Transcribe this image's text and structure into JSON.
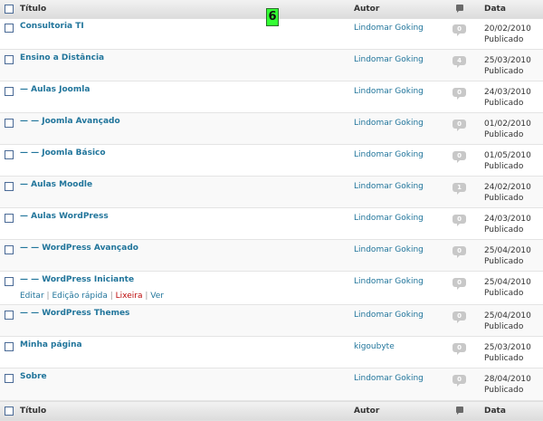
{
  "header": {
    "title": "Título",
    "author": "Autor",
    "date": "Data"
  },
  "footer": {
    "title": "Título",
    "author": "Autor",
    "date": "Data"
  },
  "badge": "6",
  "rows": [
    {
      "title": "Consultoria TI",
      "author": "Lindomar Goking",
      "comments": "0",
      "date": "20/02/2010",
      "status": "Publicado"
    },
    {
      "title": "Ensino a Distância",
      "author": "Lindomar Goking",
      "comments": "4",
      "date": "25/03/2010",
      "status": "Publicado"
    },
    {
      "title": "— Aulas Joomla",
      "author": "Lindomar Goking",
      "comments": "0",
      "date": "24/03/2010",
      "status": "Publicado"
    },
    {
      "title": "— — Joomla Avançado",
      "author": "Lindomar Goking",
      "comments": "0",
      "date": "01/02/2010",
      "status": "Publicado"
    },
    {
      "title": "— — Joomla Básico",
      "author": "Lindomar Goking",
      "comments": "0",
      "date": "01/05/2010",
      "status": "Publicado"
    },
    {
      "title": "— Aulas Moodle",
      "author": "Lindomar Goking",
      "comments": "1",
      "date": "24/02/2010",
      "status": "Publicado"
    },
    {
      "title": "— Aulas WordPress",
      "author": "Lindomar Goking",
      "comments": "0",
      "date": "24/03/2010",
      "status": "Publicado"
    },
    {
      "title": "— — WordPress Avançado",
      "author": "Lindomar Goking",
      "comments": "0",
      "date": "25/04/2010",
      "status": "Publicado"
    },
    {
      "title": "— — WordPress Iniciante",
      "author": "Lindomar Goking",
      "comments": "0",
      "date": "25/04/2010",
      "status": "Publicado"
    },
    {
      "title": "— — WordPress Themes",
      "author": "Lindomar Goking",
      "comments": "0",
      "date": "25/04/2010",
      "status": "Publicado"
    },
    {
      "title": "Minha página",
      "author": "kigoubyte",
      "comments": "0",
      "date": "25/03/2010",
      "status": "Publicado"
    },
    {
      "title": "Sobre",
      "author": "Lindomar Goking",
      "comments": "0",
      "date": "28/04/2010",
      "status": "Publicado"
    }
  ],
  "row_actions": {
    "edit": "Editar",
    "quick_edit": "Edição rápida",
    "trash": "Lixeira",
    "view": "Ver",
    "separator": "|"
  }
}
